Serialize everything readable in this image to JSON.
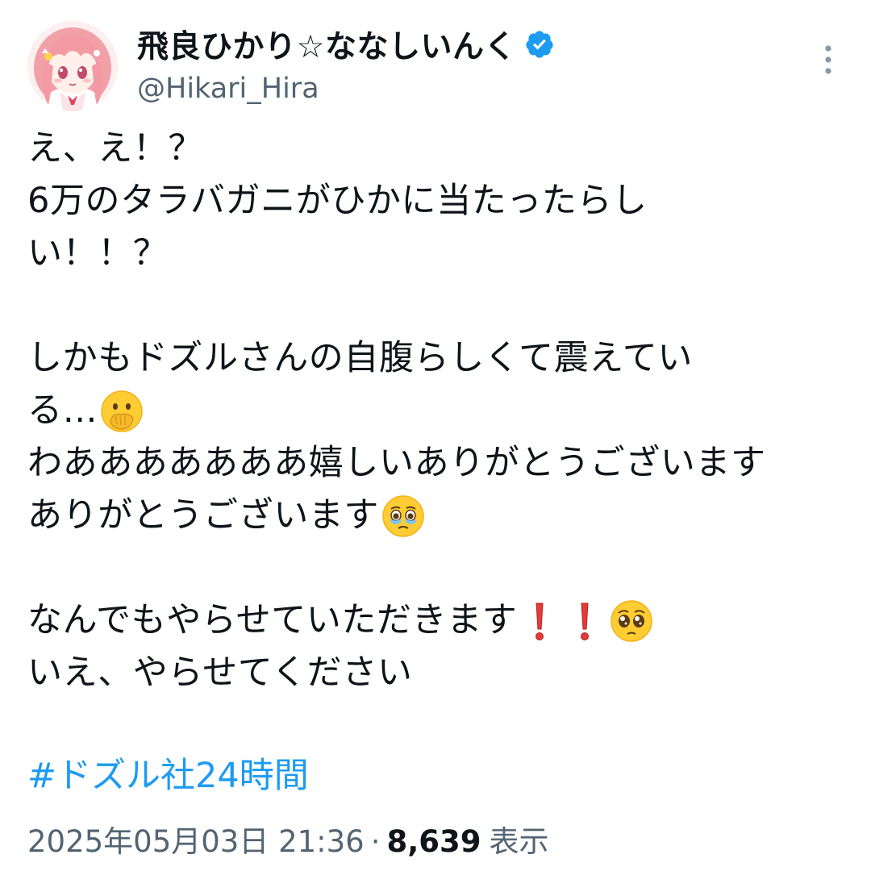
{
  "author": {
    "display_name": "飛良ひかり☆ななしいんく",
    "handle": "@Hikari_Hira",
    "verified": true
  },
  "post": {
    "lines": [
      "え、え！？",
      "6万のタラバガニがひかに当たったらし",
      "い！！？",
      "",
      "しかもドズルさんの自腹らしくて震えてい",
      "る…",
      "わあああああああ嬉しいありがとうございます",
      "ありがとうございます",
      "",
      "なんでもやらせていただきます",
      "いえ、やらせてください"
    ],
    "emojis": {
      "line5": "face-with-hand-over-mouth",
      "line7": "face-holding-back-tears",
      "line9": [
        "red-exclamation",
        "red-exclamation",
        "pleading-face"
      ]
    },
    "hashtag": "#ドズル社24時間",
    "timestamp": "2025年05月03日 21:36",
    "separator": "·",
    "views_count": "8,639",
    "views_label": "表示"
  },
  "colors": {
    "text": "#0f1419",
    "secondary": "#536471",
    "link": "#1d9bf0",
    "verified": "#1d9bf0"
  }
}
